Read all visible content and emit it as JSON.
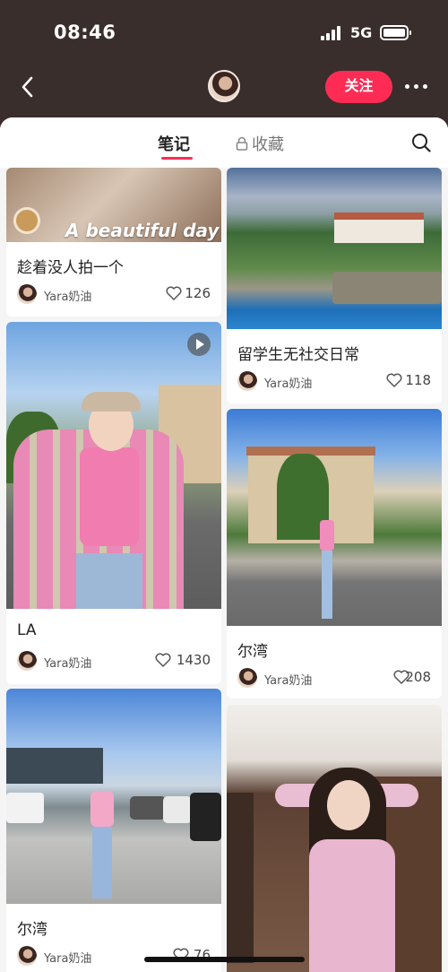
{
  "status_bar": {
    "time": "08:46",
    "network": "5G"
  },
  "nav": {
    "follow_label": "关注"
  },
  "tabs": {
    "notes": "笔记",
    "favorites": "收藏"
  },
  "feed": {
    "left": [
      {
        "title": "趁着没人拍一个",
        "author": "Yara奶油",
        "likes": "126",
        "overlay": "A beautiful day"
      },
      {
        "title": "LA",
        "author": "Yara奶油",
        "likes": "1430",
        "video": true
      },
      {
        "title": "尔湾",
        "author": "Yara奶油",
        "likes": "76"
      }
    ],
    "right": [
      {
        "title": "留学生无社交日常",
        "author": "Yara奶油",
        "likes": "118"
      },
      {
        "title": "尔湾",
        "author": "Yara奶油",
        "likes": "208"
      },
      {
        "title": "",
        "author": "",
        "likes": ""
      }
    ]
  },
  "colors": {
    "accent": "#fe2c55",
    "header_bg": "#3a2e2c"
  }
}
